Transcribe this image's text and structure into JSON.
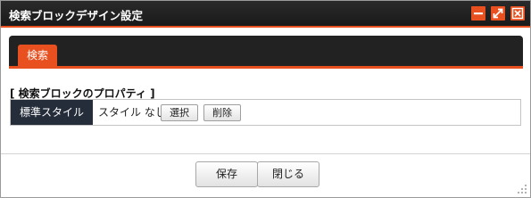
{
  "window": {
    "title": "検索ブロックデザイン設定"
  },
  "icons": {
    "minimize": "minimize-icon",
    "maximize": "maximize-icon",
    "close": "close-icon",
    "resize": "resize-grip-icon"
  },
  "colors": {
    "accent": "#e8511f",
    "titlebar": "#1f1f1f",
    "header_cell": "#252d3a"
  },
  "tabs": [
    {
      "label": "検索",
      "active": true
    }
  ],
  "properties": {
    "section_title": "[ 検索ブロックのプロパティ ]",
    "rows": [
      {
        "label": "標準スタイル",
        "value": "スタイル なし",
        "select_label": "選択",
        "delete_label": "削除"
      }
    ]
  },
  "footer": {
    "save_label": "保存",
    "close_label": "閉じる"
  }
}
